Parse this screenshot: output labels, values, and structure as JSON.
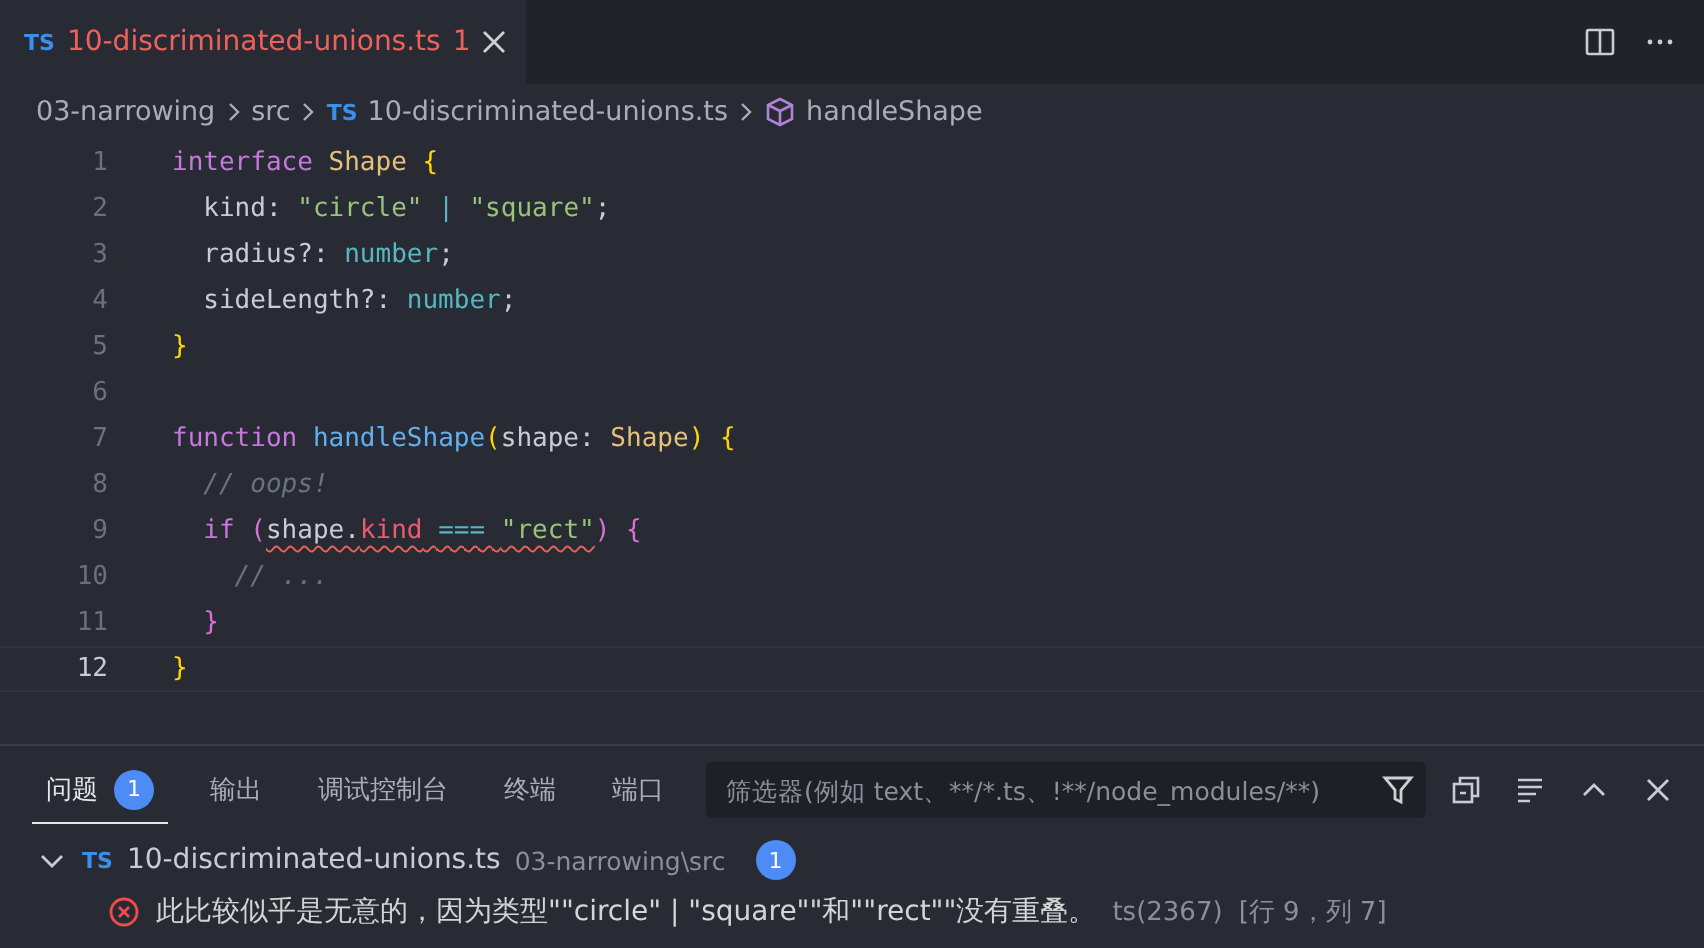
{
  "editor_tab": {
    "icon": "TS",
    "filename": "10-discriminated-unions.ts",
    "problem_count": "1",
    "has_error": true,
    "selected": true
  },
  "breadcrumbs": [
    {
      "label": "03-narrowing",
      "kind": "folder"
    },
    {
      "label": "src",
      "kind": "folder"
    },
    {
      "label": "10-discriminated-unions.ts",
      "kind": "file",
      "icon": "TS"
    },
    {
      "label": "handleShape",
      "kind": "symbol"
    }
  ],
  "code": {
    "lines": [
      {
        "number": "1",
        "current": false,
        "tokens": [
          {
            "text": "interface ",
            "kind": "keyword"
          },
          {
            "text": "Shape ",
            "kind": "type"
          },
          {
            "text": "{",
            "kind": "brace1"
          }
        ]
      },
      {
        "number": "2",
        "current": false,
        "tokens": [
          {
            "text": "  kind: ",
            "kind": "plain"
          },
          {
            "text": "\"circle\" ",
            "kind": "string"
          },
          {
            "text": "| ",
            "kind": "operator"
          },
          {
            "text": "\"square\"",
            "kind": "string"
          },
          {
            "text": ";",
            "kind": "plain"
          }
        ]
      },
      {
        "number": "3",
        "current": false,
        "tokens": [
          {
            "text": "  radius?: ",
            "kind": "plain"
          },
          {
            "text": "number",
            "kind": "number"
          },
          {
            "text": ";",
            "kind": "plain"
          }
        ]
      },
      {
        "number": "4",
        "current": false,
        "tokens": [
          {
            "text": "  sideLength?: ",
            "kind": "plain"
          },
          {
            "text": "number",
            "kind": "number"
          },
          {
            "text": ";",
            "kind": "plain"
          }
        ]
      },
      {
        "number": "5",
        "current": false,
        "tokens": [
          {
            "text": "}",
            "kind": "brace1"
          }
        ]
      },
      {
        "number": "6",
        "current": false
      },
      {
        "number": "7",
        "current": false,
        "tokens": [
          {
            "text": "function ",
            "kind": "keyword"
          },
          {
            "text": "handleShape",
            "kind": "function"
          },
          {
            "text": "(",
            "kind": "brace1"
          },
          {
            "text": "shape: ",
            "kind": "plain"
          },
          {
            "text": "Shape",
            "kind": "type"
          },
          {
            "text": ") ",
            "kind": "brace1"
          },
          {
            "text": "{",
            "kind": "brace1"
          }
        ]
      },
      {
        "number": "8",
        "current": false,
        "tokens": [
          {
            "text": "  // oops!",
            "kind": "comment"
          }
        ]
      },
      {
        "number": "9",
        "current": false,
        "tokens": [
          {
            "text": "  if ",
            "kind": "keyword"
          },
          {
            "text": "(",
            "kind": "brace2"
          },
          {
            "text": "shape.",
            "kind": "plain",
            "error": true
          },
          {
            "text": "kind",
            "kind": "property",
            "error": true
          },
          {
            "text": " === ",
            "kind": "operator",
            "error": true
          },
          {
            "text": "\"rect\"",
            "kind": "string",
            "error": true
          },
          {
            "text": ") ",
            "kind": "brace2"
          },
          {
            "text": "{",
            "kind": "brace2"
          }
        ]
      },
      {
        "number": "10",
        "current": false,
        "tokens": [
          {
            "text": "    // ...",
            "kind": "comment"
          }
        ]
      },
      {
        "number": "11",
        "current": false,
        "tokens": [
          {
            "text": "  }",
            "kind": "brace2"
          }
        ]
      },
      {
        "number": "12",
        "current": true,
        "tokens": [
          {
            "text": "}",
            "kind": "brace1"
          }
        ]
      }
    ]
  },
  "panel": {
    "tabs": [
      {
        "label": "问题",
        "badge": "1",
        "selected": true
      },
      {
        "label": "输出",
        "selected": false
      },
      {
        "label": "调试控制台",
        "selected": false
      },
      {
        "label": "终端",
        "selected": false
      },
      {
        "label": "端口",
        "selected": false
      }
    ],
    "filter": {
      "placeholder": "筛选器(例如 text、**/*.ts、!**/node_modules/**)"
    },
    "problems": [
      {
        "icon": "TS",
        "filename": "10-discriminated-unions.ts",
        "path": "03-narrowing\\src",
        "count": "1",
        "expanded": true,
        "items": [
          {
            "kind": "error",
            "message": "此比较似乎是无意的，因为类型\"\"circle\" | \"square\"\"和\"\"rect\"\"没有重叠。",
            "code": "ts(2367)",
            "location": "[行 9，列 7]"
          }
        ]
      }
    ]
  }
}
